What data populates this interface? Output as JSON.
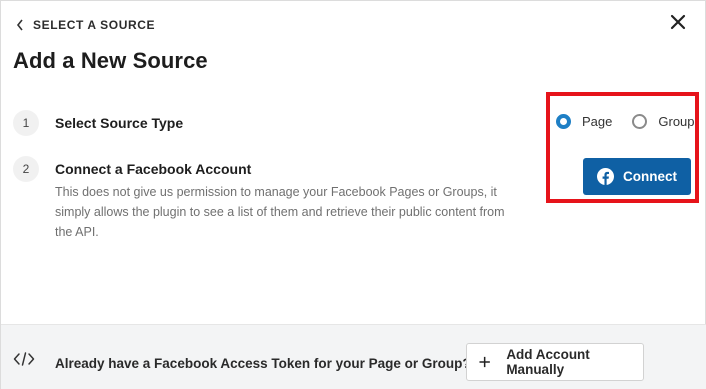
{
  "header": {
    "back_label": "SELECT A SOURCE",
    "title": "Add a New Source"
  },
  "steps": [
    {
      "number": "1",
      "title": "Select Source Type"
    },
    {
      "number": "2",
      "title": "Connect a Facebook Account",
      "description": "This does not give us permission to manage your Facebook Pages or Groups, it simply allows the plugin to see a list of them and retrieve their public content from the API."
    }
  ],
  "source_type": {
    "options": [
      "Page",
      "Group"
    ],
    "selected": "Page"
  },
  "connect_button": {
    "label": "Connect",
    "icon": "facebook-icon"
  },
  "footer": {
    "text": "Already have a Facebook Access Token for your Page or Group?",
    "button_label": "Add Account Manually"
  },
  "colors": {
    "accent": "#1e7fc5",
    "connect_bg": "#0f60a4",
    "highlight": "#e6131a",
    "footer_bg": "#f3f4f5"
  }
}
